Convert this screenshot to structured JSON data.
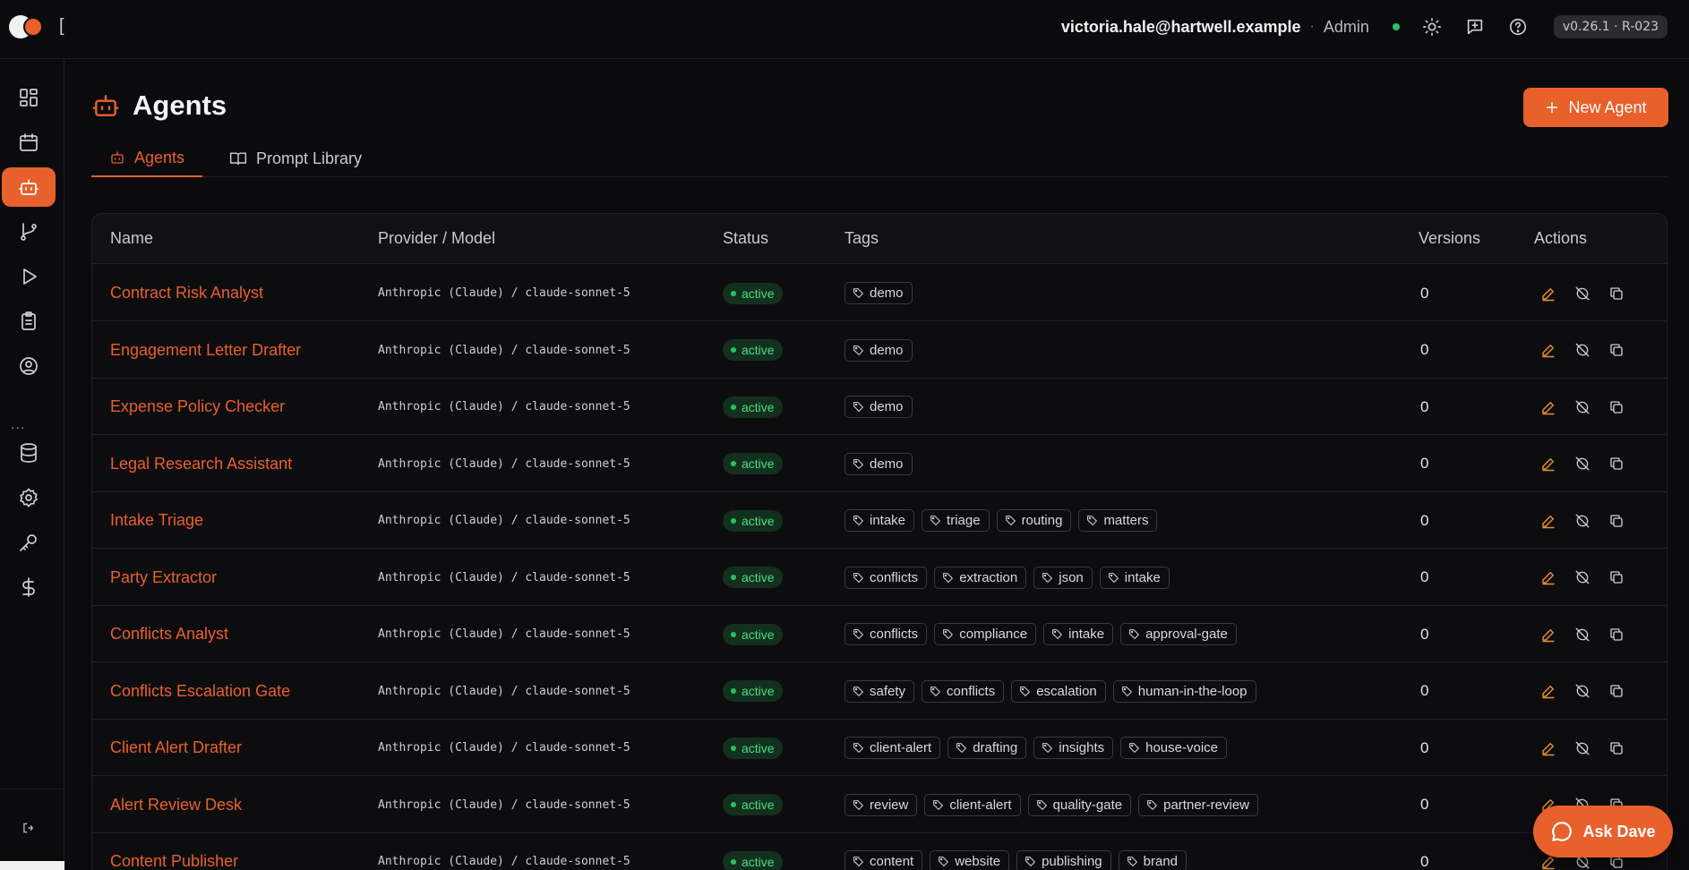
{
  "header": {
    "user_email": "victoria.hale@hartwell.example",
    "separator": "·",
    "role": "Admin",
    "version": "v0.26.1 · R-023",
    "bracket": "["
  },
  "sidebar": {
    "items": [
      {
        "icon": "dashboard-icon"
      },
      {
        "icon": "calendar-icon"
      },
      {
        "icon": "robot-icon",
        "active": true
      },
      {
        "icon": "git-branch-icon"
      },
      {
        "icon": "play-icon"
      },
      {
        "icon": "clipboard-icon"
      },
      {
        "icon": "user-circle-icon"
      },
      {
        "icon": "database-icon"
      },
      {
        "icon": "gear-icon"
      },
      {
        "icon": "key-icon"
      },
      {
        "icon": "dollar-icon"
      }
    ],
    "more": "..."
  },
  "page": {
    "title": "Agents",
    "new_button": "New Agent",
    "tabs": [
      {
        "label": "Agents",
        "active": true
      },
      {
        "label": "Prompt Library",
        "active": false
      }
    ]
  },
  "table": {
    "columns": [
      "Name",
      "Provider / Model",
      "Status",
      "Tags",
      "Versions",
      "Actions"
    ],
    "rows": [
      {
        "name": "Contract Risk Analyst",
        "model": "Anthropic (Claude) / claude-sonnet-5",
        "status": "active",
        "tags": [
          "demo"
        ],
        "versions": "0"
      },
      {
        "name": "Engagement Letter Drafter",
        "model": "Anthropic (Claude) / claude-sonnet-5",
        "status": "active",
        "tags": [
          "demo"
        ],
        "versions": "0"
      },
      {
        "name": "Expense Policy Checker",
        "model": "Anthropic (Claude) / claude-sonnet-5",
        "status": "active",
        "tags": [
          "demo"
        ],
        "versions": "0"
      },
      {
        "name": "Legal Research Assistant",
        "model": "Anthropic (Claude) / claude-sonnet-5",
        "status": "active",
        "tags": [
          "demo"
        ],
        "versions": "0"
      },
      {
        "name": "Intake Triage",
        "model": "Anthropic (Claude) / claude-sonnet-5",
        "status": "active",
        "tags": [
          "intake",
          "triage",
          "routing",
          "matters"
        ],
        "versions": "0"
      },
      {
        "name": "Party Extractor",
        "model": "Anthropic (Claude) / claude-sonnet-5",
        "status": "active",
        "tags": [
          "conflicts",
          "extraction",
          "json",
          "intake"
        ],
        "versions": "0"
      },
      {
        "name": "Conflicts Analyst",
        "model": "Anthropic (Claude) / claude-sonnet-5",
        "status": "active",
        "tags": [
          "conflicts",
          "compliance",
          "intake",
          "approval-gate"
        ],
        "versions": "0"
      },
      {
        "name": "Conflicts Escalation Gate",
        "model": "Anthropic (Claude) / claude-sonnet-5",
        "status": "active",
        "tags": [
          "safety",
          "conflicts",
          "escalation",
          "human-in-the-loop"
        ],
        "versions": "0"
      },
      {
        "name": "Client Alert Drafter",
        "model": "Anthropic (Claude) / claude-sonnet-5",
        "status": "active",
        "tags": [
          "client-alert",
          "drafting",
          "insights",
          "house-voice"
        ],
        "versions": "0"
      },
      {
        "name": "Alert Review Desk",
        "model": "Anthropic (Claude) / claude-sonnet-5",
        "status": "active",
        "tags": [
          "review",
          "client-alert",
          "quality-gate",
          "partner-review"
        ],
        "versions": "0"
      },
      {
        "name": "Content Publisher",
        "model": "Anthropic (Claude) / claude-sonnet-5",
        "status": "active",
        "tags": [
          "content",
          "website",
          "publishing",
          "brand"
        ],
        "versions": "0"
      }
    ]
  },
  "chat": {
    "label": "Ask Dave"
  },
  "colors": {
    "accent": "#e8602c",
    "status_green": "#22c55e",
    "background": "#0b0b0d"
  }
}
